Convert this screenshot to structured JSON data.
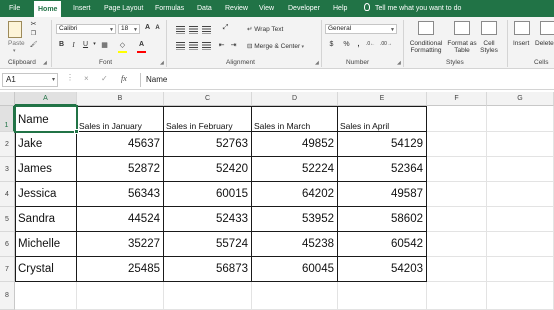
{
  "menu": {
    "tabs": [
      "File",
      "Home",
      "Insert",
      "Page Layout",
      "Formulas",
      "Data",
      "Review",
      "View",
      "Developer",
      "Help"
    ],
    "active_tab": "Home",
    "tell_me": "Tell me what you want to do"
  },
  "ribbon": {
    "clipboard": {
      "paste_label": "Paste",
      "group_label": "Clipboard"
    },
    "font": {
      "family": "Calibri",
      "size": "18",
      "group_label": "Font"
    },
    "alignment": {
      "wrap_text": "Wrap Text",
      "merge_center": "Merge & Center",
      "group_label": "Alignment"
    },
    "number": {
      "format": "General",
      "group_label": "Number"
    },
    "styles": {
      "conditional_formatting": [
        "Conditional",
        "Formatting"
      ],
      "format_as_table": [
        "Format as",
        "Table"
      ],
      "cell_styles": [
        "Cell",
        "Styles"
      ],
      "group_label": "Styles"
    },
    "cells": {
      "insert": "Insert",
      "delete": "Delete",
      "group_label": "Cells"
    },
    "colors": {
      "highlight": "#ffff00",
      "font_color": "#ff0000"
    }
  },
  "formula_bar": {
    "name_box": "A1",
    "cancel_icon": "×",
    "enter_icon": "✓",
    "fx_label": "fx",
    "content": "Name"
  },
  "sheet": {
    "columns": [
      "A",
      "B",
      "C",
      "D",
      "E",
      "F",
      "G"
    ],
    "selected_column": "A",
    "rows": [
      "1",
      "2",
      "3",
      "4",
      "5",
      "6",
      "7",
      "8"
    ],
    "selected_row": "1",
    "header_row": [
      "Name",
      "Sales in January",
      "Sales in February",
      "Sales in March",
      "Sales in April"
    ],
    "data": [
      [
        "Jake",
        "45637",
        "52763",
        "49852",
        "54129"
      ],
      [
        "James",
        "52872",
        "52420",
        "52224",
        "52364"
      ],
      [
        "Jessica",
        "56343",
        "60015",
        "64202",
        "49587"
      ],
      [
        "Sandra",
        "44524",
        "52433",
        "53952",
        "58602"
      ],
      [
        "Michelle",
        "35227",
        "55724",
        "45238",
        "60542"
      ],
      [
        "Crystal",
        "25485",
        "56873",
        "60045",
        "54203"
      ]
    ]
  },
  "accent_color": "#217346"
}
